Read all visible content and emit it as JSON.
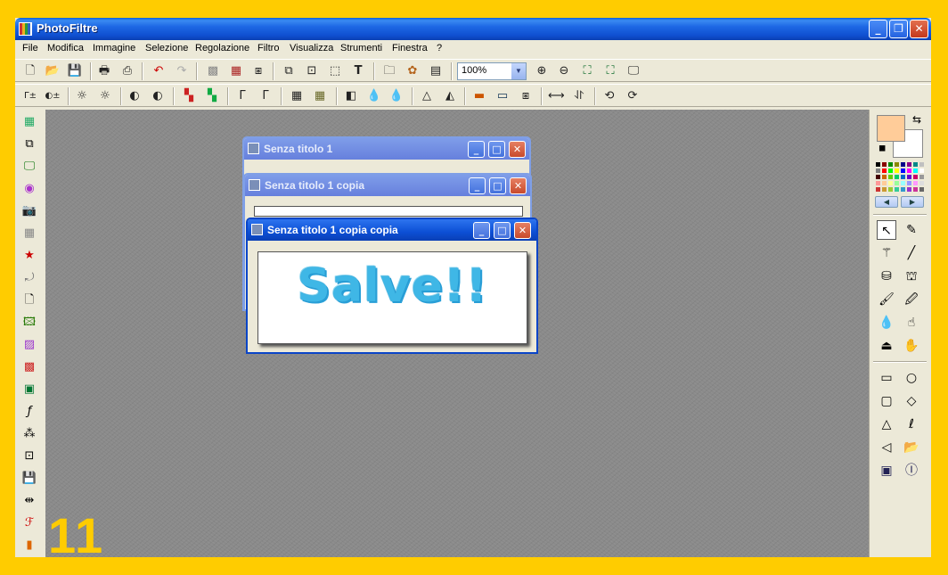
{
  "window": {
    "title": "PhotoFiltre",
    "buttons": {
      "minimize": "_",
      "maximize": "❐",
      "close": "✕"
    }
  },
  "menu": [
    "File",
    "Modifica",
    "Immagine",
    "Selezione",
    "Regolazione",
    "Filtro",
    "Visualizza",
    "Strumenti",
    "Finestra",
    "?"
  ],
  "toolbar": {
    "zoom_value": "100%"
  },
  "children": [
    {
      "title": "Senza titolo 1"
    },
    {
      "title": "Senza titolo 1 copia"
    },
    {
      "title": "Senza titolo 1 copia copia",
      "content_text": "Salve!!"
    }
  ],
  "child_buttons": {
    "minimize": "_",
    "maximize": "□",
    "close": "✕"
  },
  "palette_nav": {
    "prev": "◀",
    "next": "▶"
  },
  "overlay_number": "11",
  "colors": {
    "foreground": "#FFCC99",
    "background": "#FFFFFF",
    "border": "#FFCC00",
    "xp_titlebar": "#0F4FD0"
  }
}
